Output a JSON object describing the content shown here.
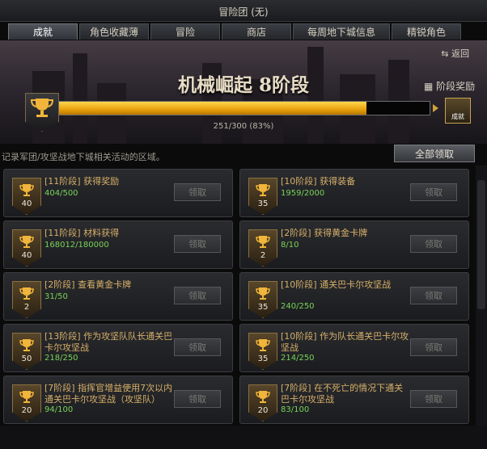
{
  "window": {
    "title": "冒险团 (无)"
  },
  "tabs": [
    "成就",
    "角色收藏薄",
    "冒险",
    "商店",
    "每周地下城信息",
    "精锐角色"
  ],
  "active_tab": 0,
  "back_label": "返回",
  "stage": {
    "title": "机械崛起 8阶段",
    "reward_label": "阶段奖励",
    "progress_text": "251/300 (83%)",
    "progress_fraction": 0.83,
    "chest_label": "成就"
  },
  "area_description": "记录军团/攻坚战地下城相关活动的区域。",
  "claim_all_label": "全部领取",
  "claim_label": "领取",
  "colors": {
    "gold": "#e8a00d",
    "green": "#79d35a",
    "title_gold": "#d7b06a"
  },
  "achievements": [
    {
      "level": "40",
      "title": "[11阶段] 获得奖励",
      "progress": "404/500"
    },
    {
      "level": "35",
      "title": "[10阶段] 获得装备",
      "progress": "1959/2000"
    },
    {
      "level": "40",
      "title": "[11阶段] 材料获得",
      "progress": "168012/180000"
    },
    {
      "level": "2",
      "title": "[2阶段] 获得黄金卡牌",
      "progress": "8/10"
    },
    {
      "level": "2",
      "title": "[2阶段] 查看黄金卡牌",
      "progress": "31/50"
    },
    {
      "level": "35",
      "title": "[10阶段] 通关巴卡尔攻坚战",
      "progress": "240/250"
    },
    {
      "level": "50",
      "title": "[13阶段] 作为攻坚队队长通关巴卡尔攻坚战",
      "progress": "218/250"
    },
    {
      "level": "35",
      "title": "[10阶段] 作为队长通关巴卡尔攻坚战",
      "progress": "214/250"
    },
    {
      "level": "20",
      "title": "[7阶段] 指挥官增益使用7次以内通关巴卡尔攻坚战（攻坚队）",
      "progress": "94/100"
    },
    {
      "level": "20",
      "title": "[7阶段] 在不死亡的情况下通关巴卡尔攻坚战",
      "progress": "83/100"
    }
  ]
}
